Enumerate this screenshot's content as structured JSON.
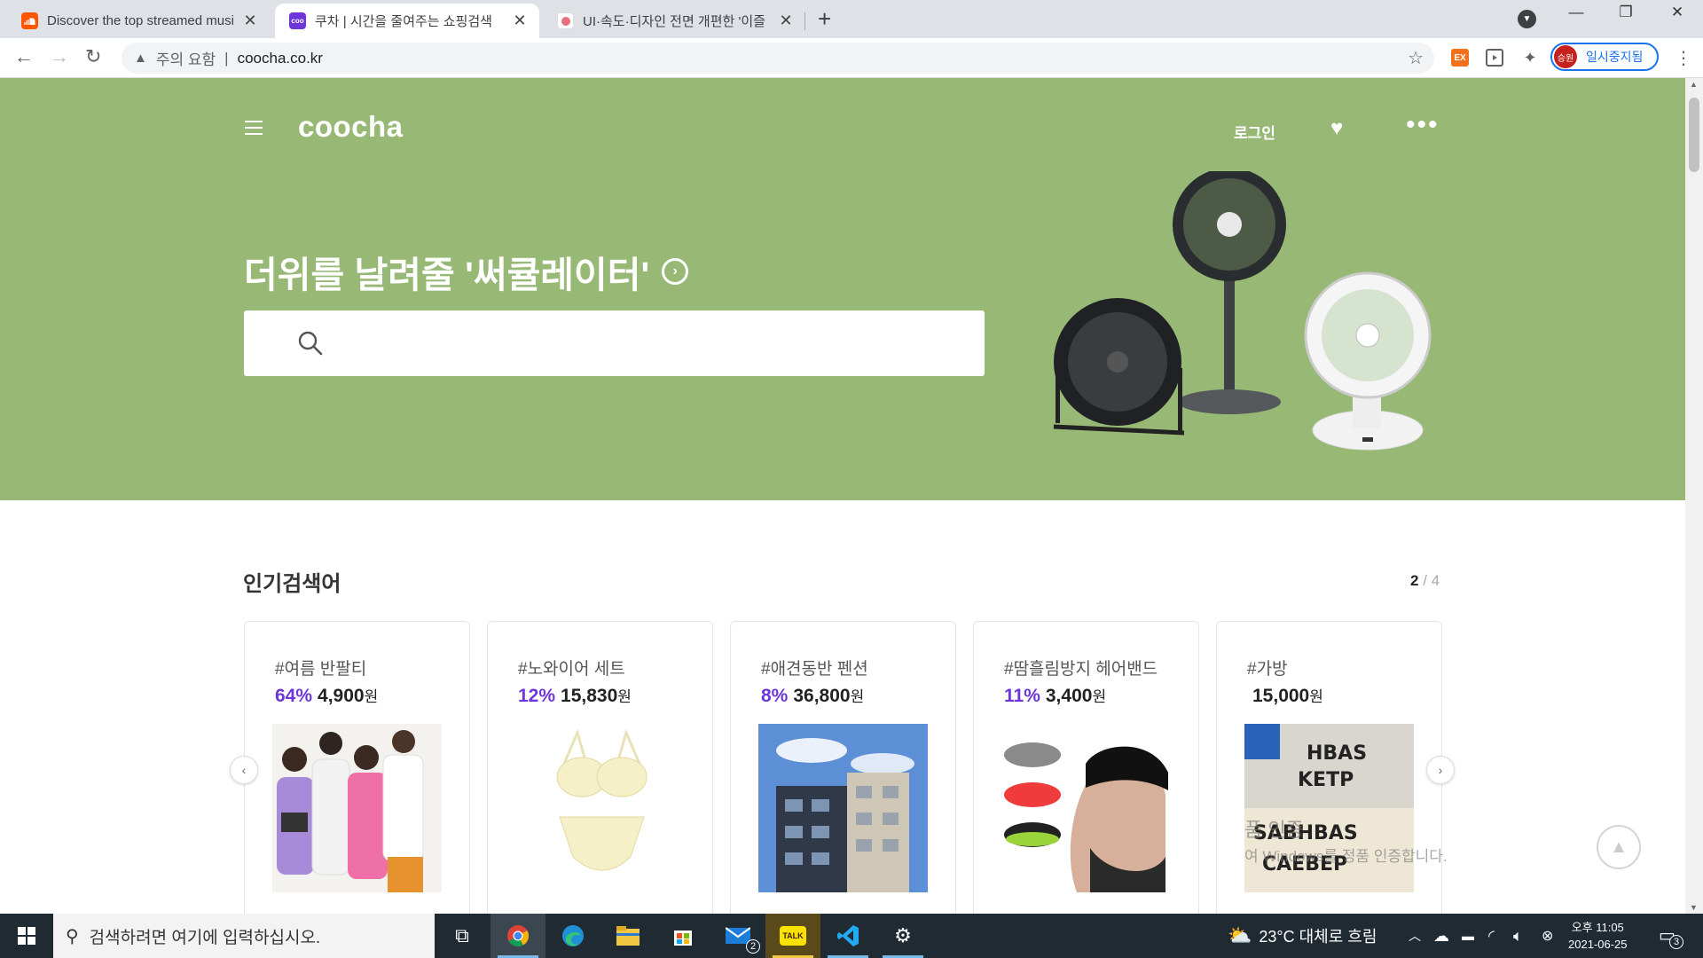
{
  "browser": {
    "tabs": [
      {
        "title": "Discover the top streamed musi",
        "favicon": "soundcloud-icon",
        "favicon_color": "#ff5500"
      },
      {
        "title": "쿠차 | 시간을 줄여주는 쇼핑검색",
        "favicon": "coocha-icon",
        "favicon_color": "#6d36d8",
        "favicon_text": "coo"
      },
      {
        "title": "UI·속도·디자인 전면 개편한 '이즐",
        "favicon": "news-icon",
        "favicon_color": "#e8707a"
      }
    ],
    "address": {
      "security": "주의 요함",
      "url": "coocha.co.kr"
    },
    "extensions": {
      "ex_label": "EX"
    },
    "profile": {
      "avatar_text": "승원",
      "status": "일시중지됨"
    }
  },
  "hero": {
    "bg_color": "#97b975",
    "logo": "coocha",
    "login": "로그인",
    "headline": "더위를 날려줄 '써큘레이터'",
    "search_placeholder": ""
  },
  "popular": {
    "title": "인기검색어",
    "page_current": "2",
    "page_sep": "/",
    "page_total": "4",
    "cards": [
      {
        "keyword": "#여름 반팔티",
        "discount": "64%",
        "price": "4,900",
        "unit": "원"
      },
      {
        "keyword": "#노와이어 세트",
        "discount": "12%",
        "price": "15,830",
        "unit": "원"
      },
      {
        "keyword": "#애견동반 펜션",
        "discount": "8%",
        "price": "36,800",
        "unit": "원"
      },
      {
        "keyword": "#땀흘림방지 헤어밴드",
        "discount": "11%",
        "price": "3,400",
        "unit": "원"
      },
      {
        "keyword": "#가방",
        "discount": "",
        "price": "15,000",
        "unit": "원"
      }
    ],
    "accent_color": "#6d36d8"
  },
  "watermark": {
    "line1": "품 인증",
    "line2": "여 Windows를 정품 인증합니다."
  },
  "taskbar": {
    "search_placeholder": "검색하려면 여기에 입력하십시오.",
    "mail_badge": "2",
    "kakao_label": "TALK",
    "weather": "23°C  대체로 흐림",
    "time": "오후 11:05",
    "date": "2021-06-25",
    "notif_count": "3"
  }
}
